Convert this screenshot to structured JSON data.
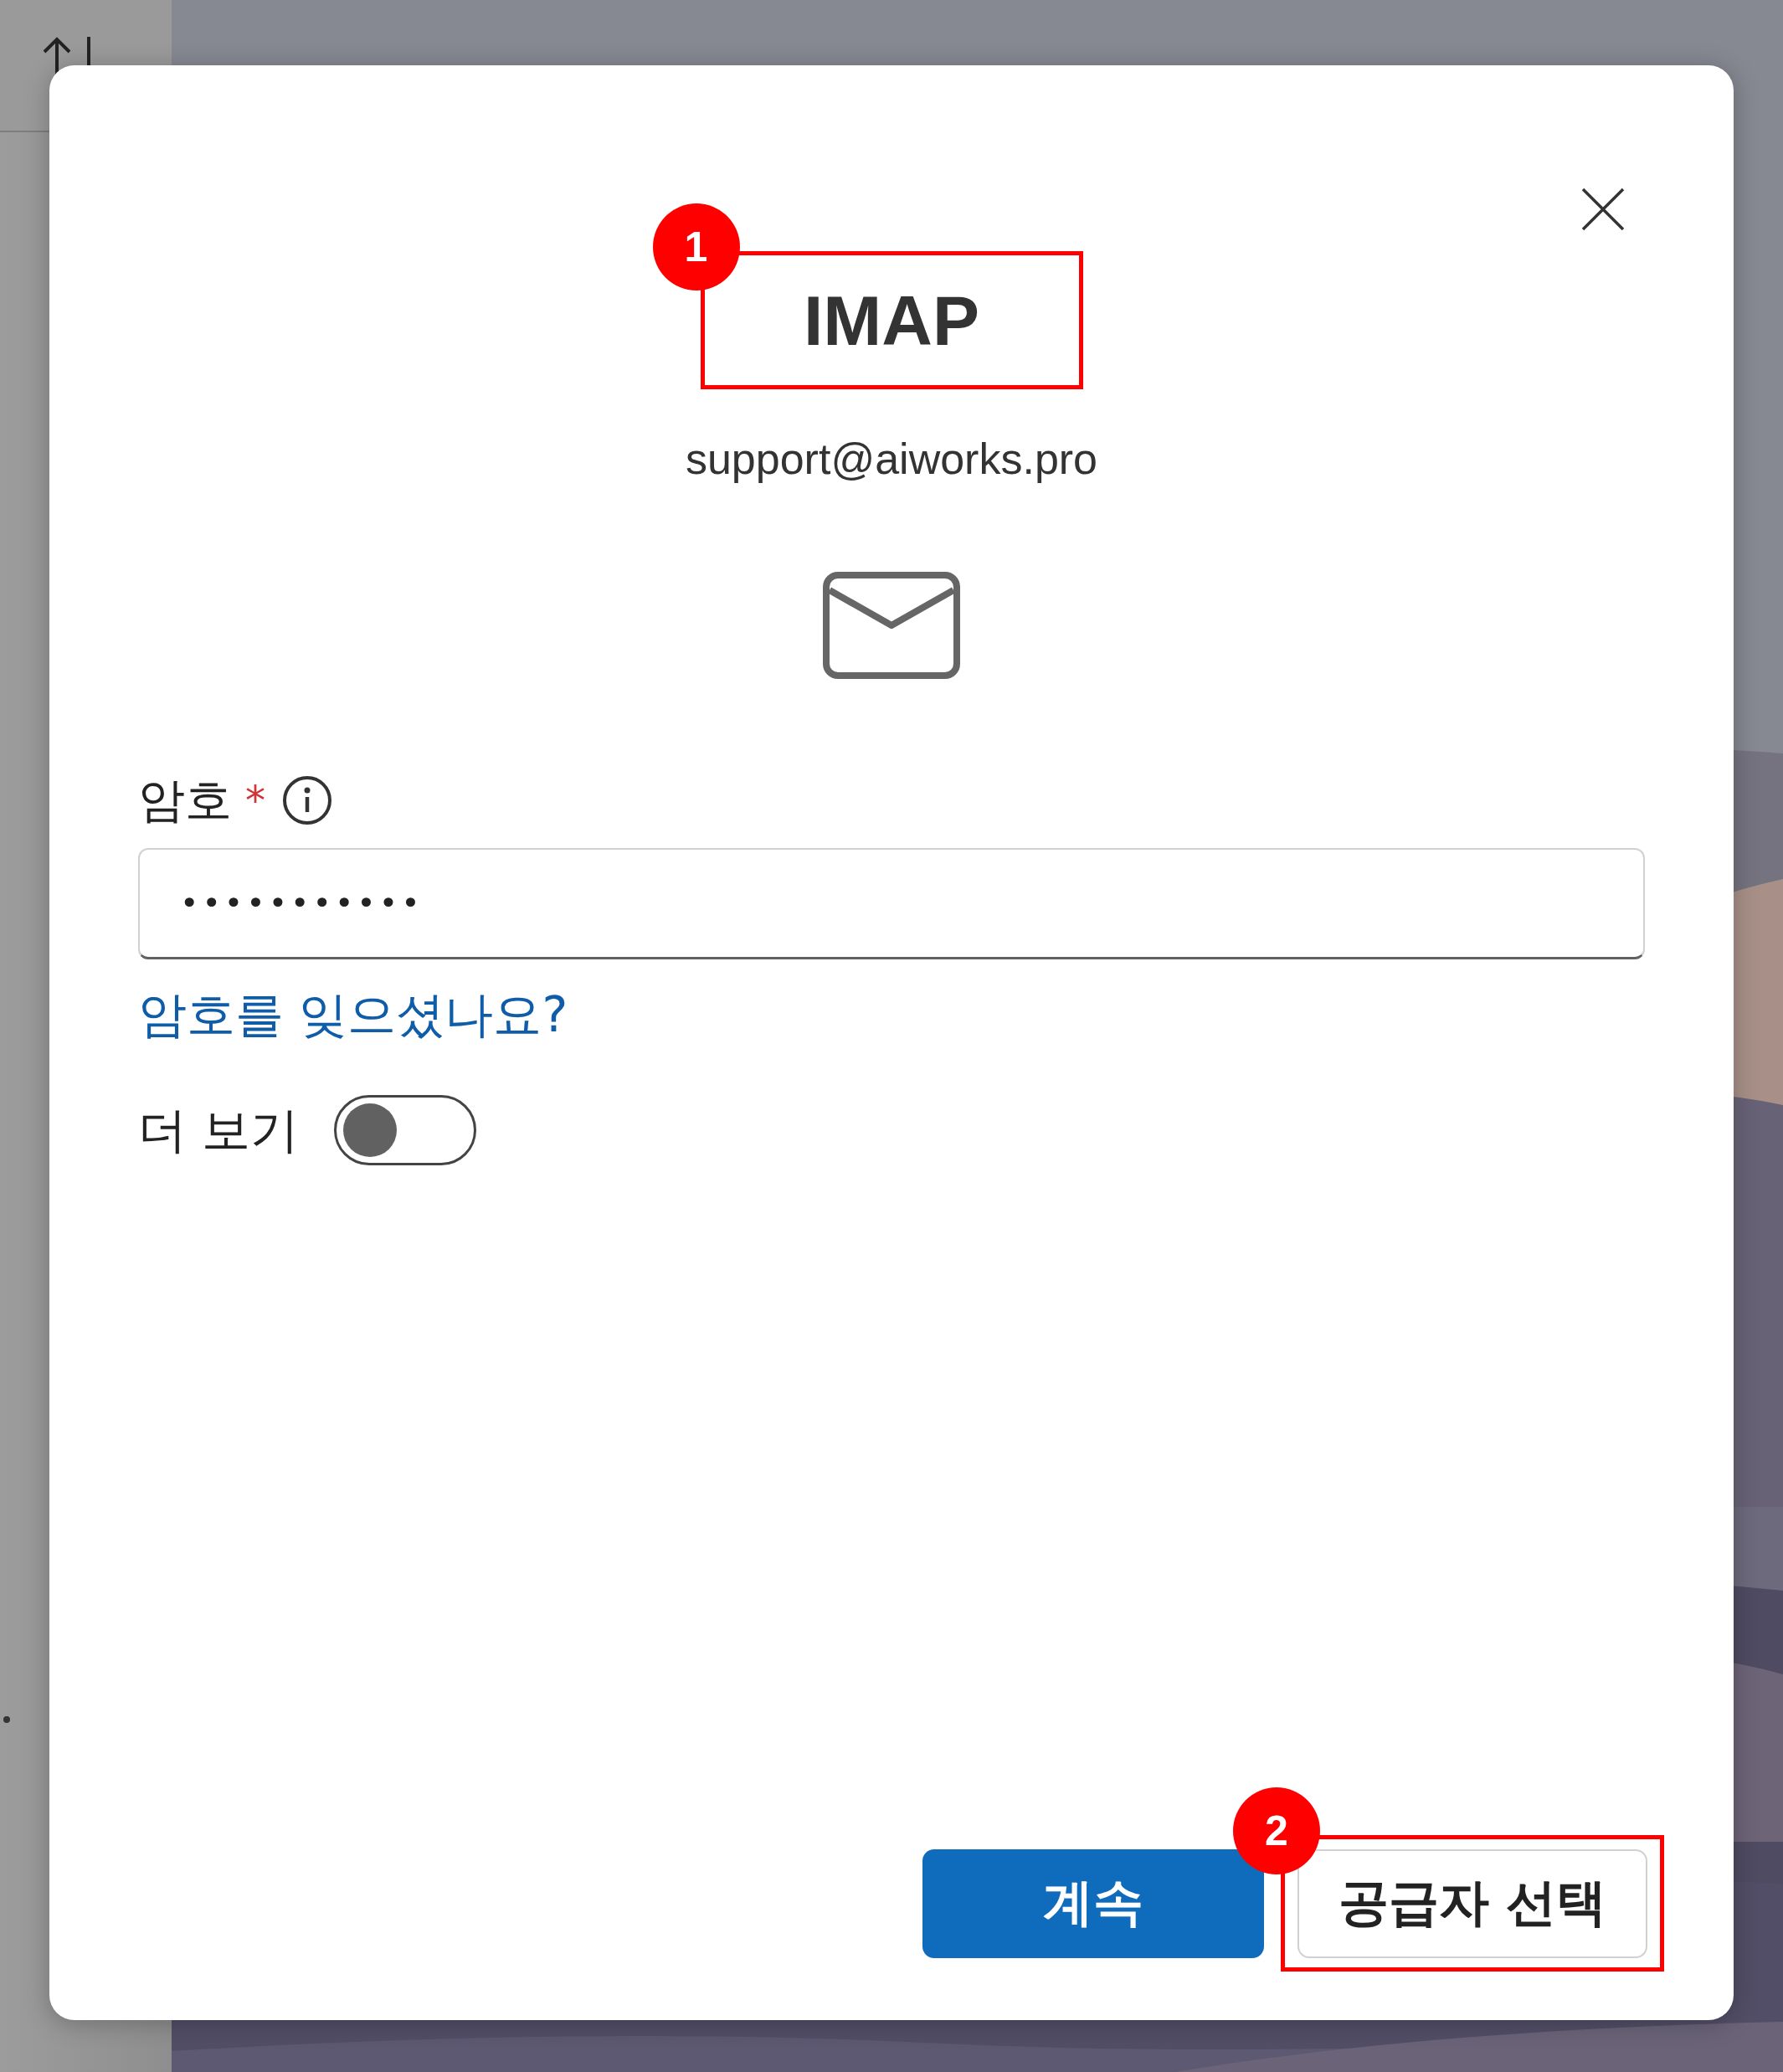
{
  "dialog": {
    "title": {
      "text": "IMAP",
      "annotation": "1"
    },
    "account": "support@aiworks.pro",
    "password": {
      "label": "암호",
      "required_mark": "*",
      "value": "•••••••••••"
    },
    "forgot_link": "암호를 잊으셨나요?",
    "more": {
      "label": "더 보기",
      "on": false
    },
    "buttons": [
      {
        "label": "계속",
        "kind": "primary"
      },
      {
        "label": "공급자 선택",
        "kind": "secondary",
        "annotation": "2"
      }
    ]
  }
}
